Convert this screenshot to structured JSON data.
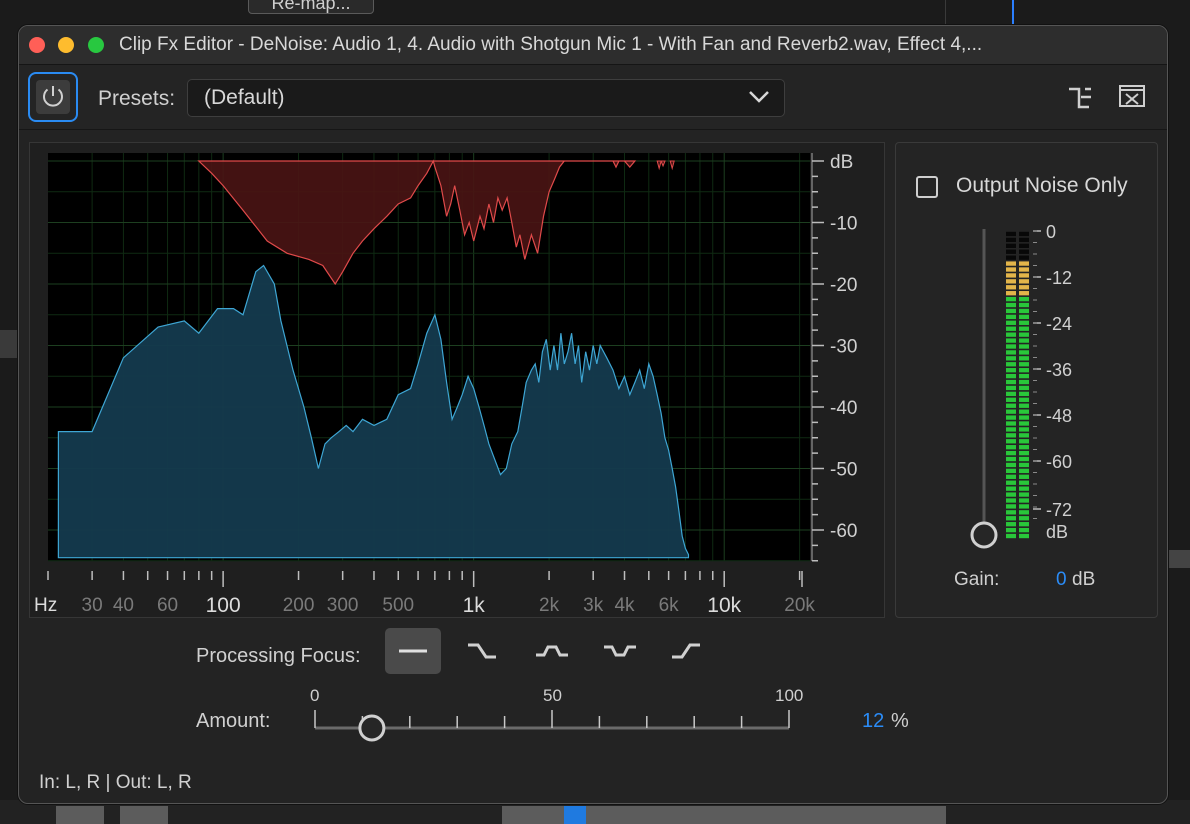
{
  "background": {
    "top_button_label": "Re-map..."
  },
  "window": {
    "title": "Clip Fx Editor - DeNoise: Audio 1, 4. Audio with Shotgun Mic 1 - With Fan and Reverb2.wav, Effect 4,..."
  },
  "toolbar": {
    "presets_label": "Presets:",
    "presets_value": "(Default)"
  },
  "graph": {
    "db_labels": [
      "dB",
      "-10",
      "-20",
      "-30",
      "-40",
      "-50",
      "-60"
    ],
    "hz_unit": "Hz",
    "freq_labels_major": [
      "100",
      "1k",
      "10k"
    ],
    "freq_labels_minor": [
      "30",
      "40",
      "60",
      "200",
      "300",
      "500",
      "2k",
      "3k",
      "4k",
      "6k",
      "20k"
    ],
    "noise_color": "#e04a4a",
    "signal_color": "#3ea6d4"
  },
  "output_panel": {
    "output_noise_only_label": "Output Noise Only",
    "output_noise_only_checked": false,
    "meter_labels": [
      "0",
      "-12",
      "-24",
      "-36",
      "-48",
      "-60",
      "-72",
      "dB"
    ],
    "gain_label": "Gain:",
    "gain_value": "0",
    "gain_unit": "dB"
  },
  "processing": {
    "focus_label": "Processing Focus:",
    "focus_options": [
      "flat",
      "low-frequency",
      "mid-frequency",
      "notch",
      "high-frequency"
    ],
    "focus_selected": "flat"
  },
  "amount": {
    "label": "Amount:",
    "scale_min": "0",
    "scale_mid": "50",
    "scale_max": "100",
    "value": "12",
    "unit": "%"
  },
  "footer": {
    "io_text": "In: L, R | Out: L, R"
  }
}
